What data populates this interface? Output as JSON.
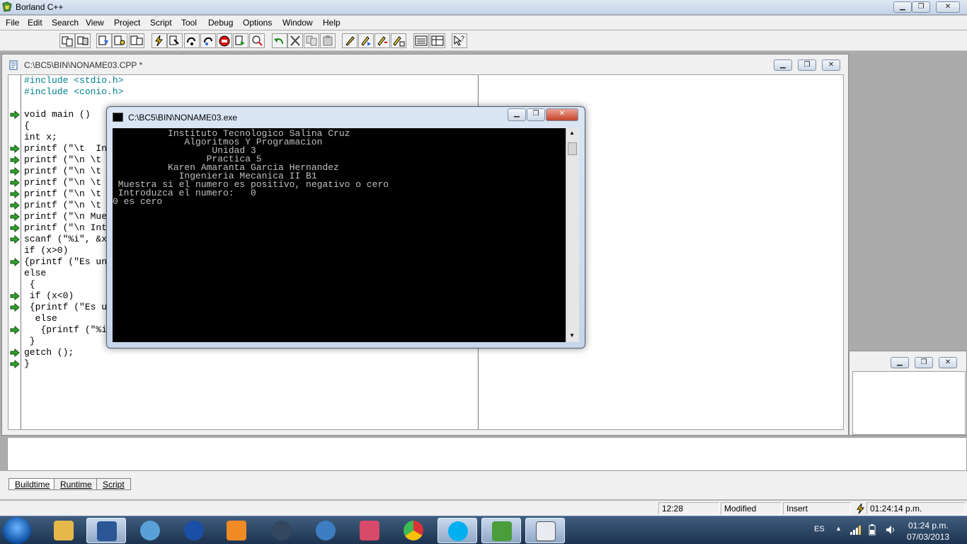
{
  "app": {
    "title": "Borland C++"
  },
  "menu": [
    "File",
    "Edit",
    "Search",
    "View",
    "Project",
    "Script",
    "Tool",
    "Debug",
    "Options",
    "Window",
    "Help"
  ],
  "editor": {
    "title": "C:\\BC5\\BIN\\NONAME03.CPP *",
    "lines": [
      "#include <stdio.h>",
      "#include <conio.h>",
      "",
      "void main ()",
      "{",
      "int x;",
      "printf (\"\\t  In",
      "printf (\"\\n \\t",
      "printf (\"\\n \\t",
      "printf (\"\\n \\t",
      "printf (\"\\n \\t",
      "printf (\"\\n \\t",
      "printf (\"\\n Mue",
      "printf (\"\\n Int",
      "scanf (\"%i\", &x",
      "if (x>0)",
      "{printf (\"Es un",
      "else",
      " {",
      " if (x<0)",
      " {printf (\"Es u",
      "  else",
      "   {printf (\"%i",
      " }",
      "getch ();",
      "}"
    ]
  },
  "console": {
    "title": "C:\\BC5\\BIN\\NONAME03.exe",
    "lines": [
      "          Instituto Tecnologico Salina Cruz",
      "             Algoritmos Y Programacion",
      "                  Unidad 3",
      "                 Practica 5",
      "          Karen Amaranta Garcia Hernandez",
      "            Ingenieria Mecanica II B1",
      " Muestra si el numero es positivo, negativo o cero",
      " Introduzca el numero:   0",
      "0 es cero"
    ]
  },
  "tabs": [
    "Buildtime",
    "Runtime",
    "Script"
  ],
  "status": {
    "position": "12:28",
    "modified": "Modified",
    "insert": "Insert",
    "time": "01:24:14 p.m."
  },
  "taskbar": {
    "lang": "ES",
    "clock_time": "01:24 p.m.",
    "clock_date": "07/03/2013"
  }
}
